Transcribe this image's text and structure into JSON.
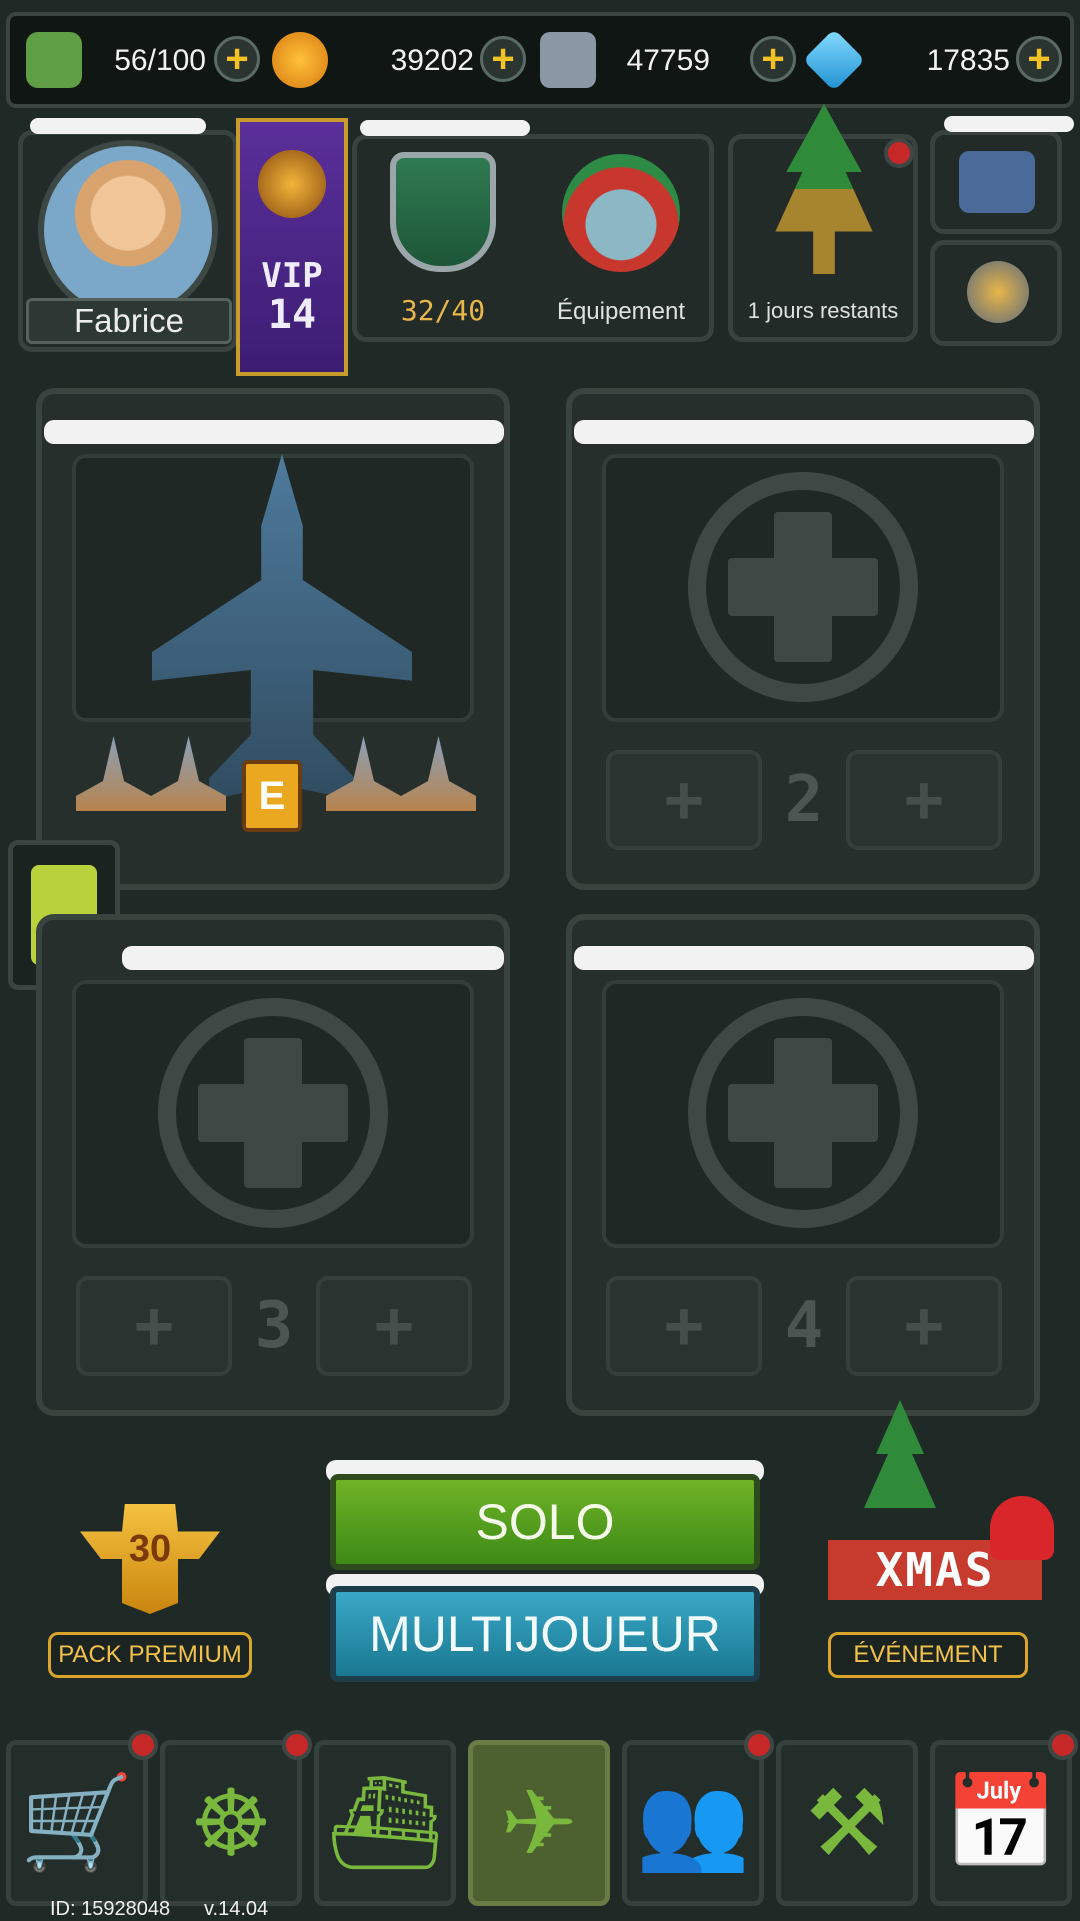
{
  "currencies": [
    {
      "name": "fuel",
      "value": "56/100",
      "icon": "fuel-can-icon",
      "color": "#6fae4d"
    },
    {
      "name": "gold",
      "value": "39202",
      "icon": "gold-coin-icon",
      "color": "#f0a623"
    },
    {
      "name": "parts",
      "value": "47759",
      "icon": "wrench-icon",
      "color": "#b7c5d4"
    },
    {
      "name": "gems",
      "value": "17835",
      "icon": "diamond-icon",
      "color": "#33b8ef"
    }
  ],
  "profile": {
    "name": "Fabrice",
    "vip_label": "VIP",
    "vip_level": "14"
  },
  "rank": {
    "progress": "32/40"
  },
  "equipment": {
    "label": "Équipement"
  },
  "event_trophy": {
    "label": "1 jours restants"
  },
  "slots": [
    {
      "number": "E",
      "filled": true
    },
    {
      "number": "2",
      "filled": false
    },
    {
      "number": "3",
      "filled": false
    },
    {
      "number": "4",
      "filled": false
    }
  ],
  "buttons": {
    "solo": "SOLO",
    "multiplayer": "MULTIJOUEUR"
  },
  "premium": {
    "badge": "30",
    "label": "PACK PREMIUM"
  },
  "event": {
    "label": "ÉVÉNEMENT",
    "banner": "XMAS"
  },
  "bottom_nav": [
    {
      "name": "shop",
      "icon": "cart-icon",
      "glyph": "🛒",
      "badge": true
    },
    {
      "name": "wheel",
      "icon": "wheel-icon",
      "glyph": "☸",
      "badge": true
    },
    {
      "name": "ship",
      "icon": "battleship-icon",
      "glyph": "⛴",
      "badge": false
    },
    {
      "name": "plane",
      "icon": "jet-icon",
      "glyph": "✈",
      "badge": false,
      "active": true
    },
    {
      "name": "social",
      "icon": "friends-icon",
      "glyph": "👥",
      "badge": true
    },
    {
      "name": "workshop",
      "icon": "tools-icon",
      "glyph": "⚒",
      "badge": false
    },
    {
      "name": "calendar",
      "icon": "calendar-icon",
      "glyph": "📅",
      "badge": true
    }
  ],
  "footer": {
    "id": "ID: 15928048",
    "version": "v.14.04"
  },
  "colors": {
    "accent_green": "#4f8f1e",
    "accent_blue": "#1f8fb0",
    "gold": "#f4c323",
    "badge_red": "#c62828"
  }
}
